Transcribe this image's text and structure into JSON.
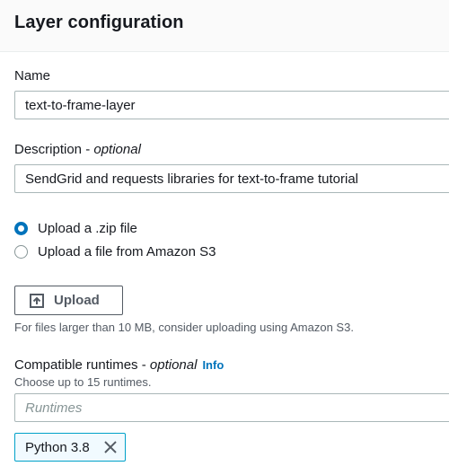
{
  "header": {
    "title": "Layer configuration"
  },
  "name_field": {
    "label": "Name",
    "value": "text-to-frame-layer"
  },
  "description_field": {
    "label": "Description - ",
    "label_optional": "optional",
    "value": "SendGrid and requests libraries for text-to-frame tutorial"
  },
  "upload_options": [
    {
      "label": "Upload a .zip file",
      "checked": true
    },
    {
      "label": "Upload a file from Amazon S3",
      "checked": false
    }
  ],
  "upload_button": {
    "label": "Upload",
    "icon": "upload-icon"
  },
  "upload_hint": "For files larger than 10 MB, consider uploading using Amazon S3.",
  "runtimes_field": {
    "label": "Compatible runtimes - ",
    "label_optional": "optional",
    "info_link": "Info",
    "description": "Choose up to 15 runtimes.",
    "placeholder": "Runtimes",
    "selected": [
      {
        "label": "Python 3.8",
        "icon": "close-icon"
      }
    ]
  },
  "colors": {
    "accent": "#0073bb",
    "token_border": "#00a1c9",
    "token_bg": "#f1faff",
    "text": "#16191f",
    "secondary_text": "#545b64"
  }
}
